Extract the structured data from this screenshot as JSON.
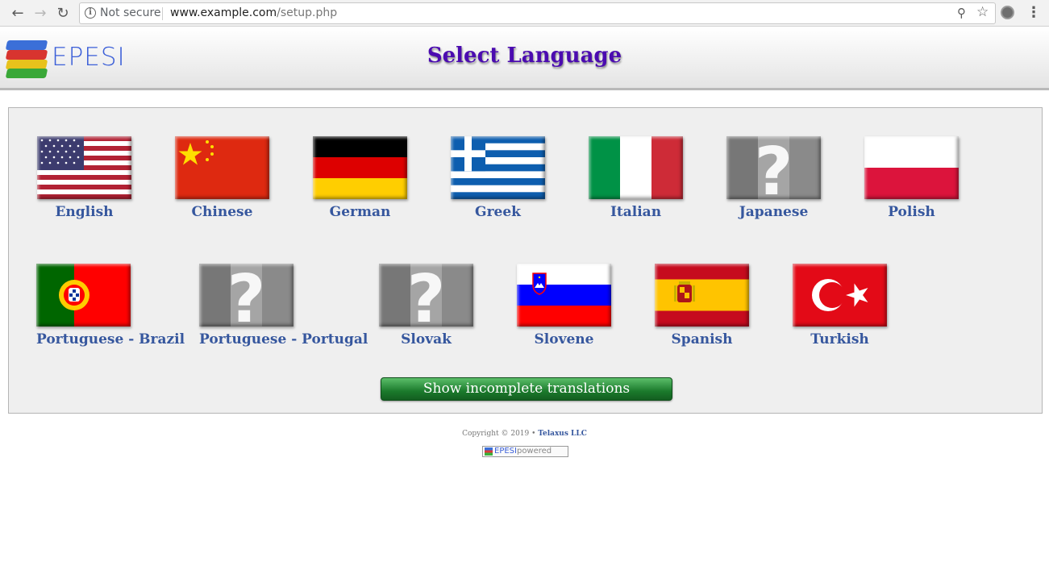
{
  "browser": {
    "security_label": "Not secure",
    "url_host": "www.example.com",
    "url_path": "/setup.php"
  },
  "header": {
    "logo_text": "EPESI",
    "title": "Select Language"
  },
  "languages_row1": [
    {
      "label": "English",
      "flag": "us-flag"
    },
    {
      "label": "Chinese",
      "flag": "china-flag"
    },
    {
      "label": "German",
      "flag": "germany-flag"
    },
    {
      "label": "Greek",
      "flag": "greece-flag"
    },
    {
      "label": "Italian",
      "flag": "italy-flag"
    },
    {
      "label": "Japanese",
      "flag": "unknown-flag"
    },
    {
      "label": "Polish",
      "flag": "poland-flag"
    }
  ],
  "languages_row2": [
    {
      "label": "Portuguese - Brazil",
      "flag": "portugal-flag"
    },
    {
      "label": "Portuguese - Portugal",
      "flag": "unknown-flag"
    },
    {
      "label": "Slovak",
      "flag": "unknown-flag"
    },
    {
      "label": "Slovene",
      "flag": "slovenia-flag"
    },
    {
      "label": "Spanish",
      "flag": "spain-flag"
    },
    {
      "label": "Turkish",
      "flag": "turkey-flag"
    }
  ],
  "show_incomplete_label": "Show incomplete translations",
  "footer": {
    "copyright_text": "Copyright © 2019 •",
    "company": "Telaxus LLC",
    "powered_brand": "EPESI",
    "powered_word": "powered"
  },
  "colors": {
    "title": "#4b0bb0",
    "label": "#36579e",
    "button": "#1b7a2c"
  }
}
